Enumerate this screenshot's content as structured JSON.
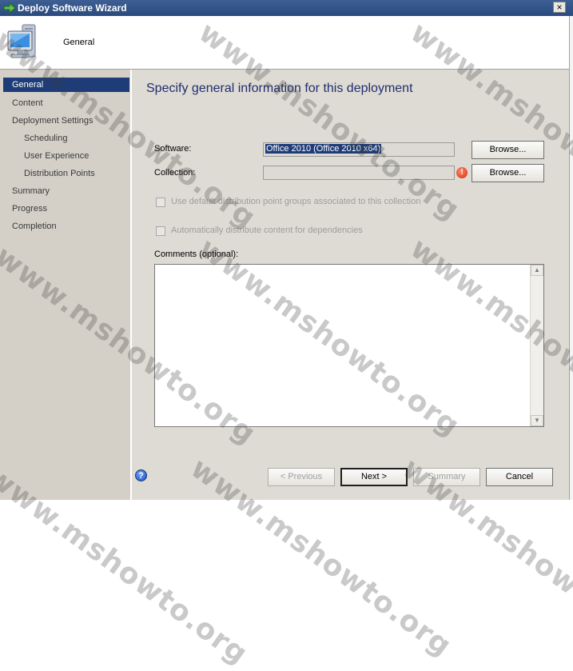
{
  "window": {
    "title": "Deploy Software Wizard",
    "close_label": "×"
  },
  "header": {
    "title": "General"
  },
  "sidebar": {
    "items": [
      {
        "label": "General",
        "active": true
      },
      {
        "label": "Content"
      },
      {
        "label": "Deployment Settings"
      },
      {
        "label": "Scheduling"
      },
      {
        "label": "User Experience"
      },
      {
        "label": "Distribution Points"
      },
      {
        "label": "Summary"
      },
      {
        "label": "Progress"
      },
      {
        "label": "Completion"
      }
    ]
  },
  "main": {
    "heading": "Specify general information for this deployment",
    "software_label": "Software:",
    "software_value": "Office 2010 (Office 2010 x64)",
    "collection_label": "Collection:",
    "collection_value": "",
    "browse_label": "Browse...",
    "default_dp_label": "Use default distribution point groups associated to this collection",
    "auto_distribute_label": "Automatically distribute content for dependencies",
    "comments_label": "Comments (optional):",
    "error_glyph": "!"
  },
  "footer": {
    "help_glyph": "?",
    "previous_label": "< Previous",
    "next_label": "Next >",
    "summary_label": "Summary",
    "cancel_label": "Cancel"
  },
  "watermark": {
    "text": "www.mshowto.org"
  },
  "colors": {
    "titlebar": "#2a4a7e",
    "selected": "#1e3c78",
    "heading": "#1f2e6e",
    "panel": "#d4d0c8"
  }
}
